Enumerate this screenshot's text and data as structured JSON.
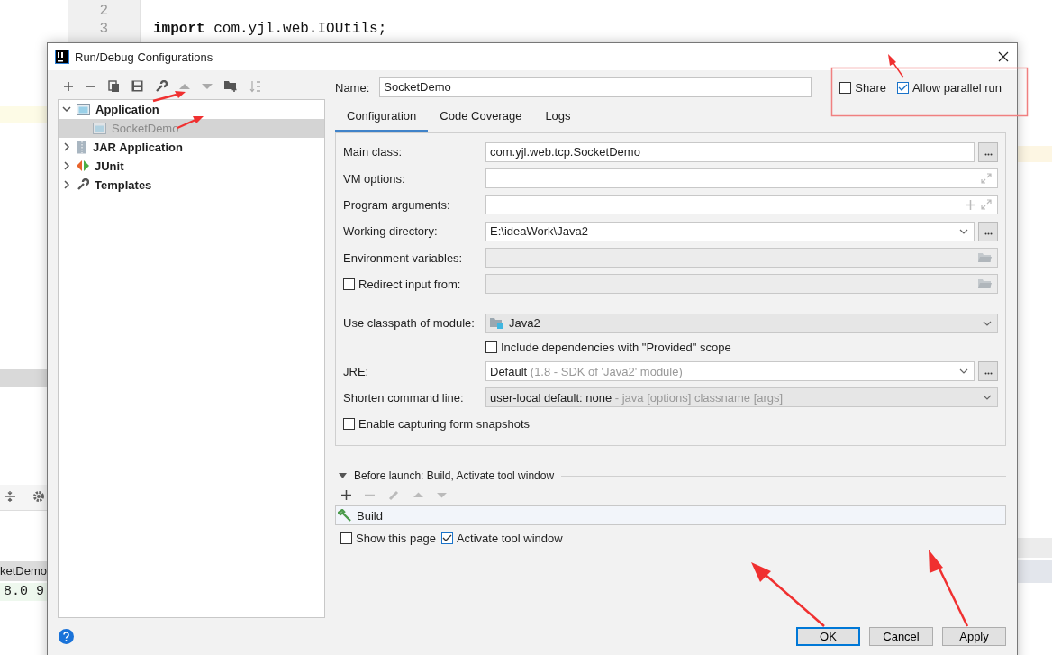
{
  "editor": {
    "lines": [
      {
        "number": "2"
      },
      {
        "number": "3",
        "code": "**import** com.yjl.web.IOUtils;"
      }
    ],
    "run_tab": "ketDemo",
    "console_text": "8.0_9"
  },
  "dialog": {
    "title": "Run/Debug Configurations",
    "tree": [
      {
        "label": "Application",
        "kind": "app",
        "expanded": true,
        "selected": false,
        "children": [
          {
            "label": "SocketDemo",
            "kind": "app",
            "selected": true
          }
        ]
      },
      {
        "label": "JAR Application",
        "kind": "jar",
        "expanded": false,
        "selected": false
      },
      {
        "label": "JUnit",
        "kind": "junit",
        "expanded": false,
        "selected": false
      },
      {
        "label": "Templates",
        "kind": "templates",
        "expanded": false,
        "selected": false
      }
    ],
    "name_label": "Name:",
    "name_value": "SocketDemo",
    "share": {
      "label": "Share",
      "checked": false
    },
    "allow_parallel": {
      "label": "Allow parallel run",
      "checked": true
    },
    "tabs": [
      {
        "label": "Configuration",
        "selected": true
      },
      {
        "label": "Code Coverage",
        "selected": false
      },
      {
        "label": "Logs",
        "selected": false
      }
    ],
    "rows": [
      {
        "kind": "field",
        "label": "Main class:",
        "value": "com.yjl.web.tcp.SocketDemo"
      },
      {
        "kind": "expand",
        "label": "VM options:"
      },
      {
        "kind": "expand_add",
        "label": "Program arguments:"
      },
      {
        "kind": "combo",
        "label": "Working directory:",
        "value": "E:\\ideaWork\\Java2"
      },
      {
        "kind": "folder",
        "label": "Environment variables:"
      },
      {
        "kind": "check_folder",
        "label": "Redirect input from:",
        "checked": false
      },
      {
        "kind": "module",
        "label": "Use classpath of module:",
        "value": "Java2"
      },
      {
        "kind": "check",
        "label": "Include dependencies with \"Provided\" scope",
        "checked": false
      },
      {
        "kind": "jre",
        "label": "JRE:",
        "value": "Default",
        "hint": "(1.8 - SDK of 'Java2' module)"
      },
      {
        "kind": "select",
        "label": "Shorten command line:",
        "value": "user-local default: none",
        "hint": "- java [options] classname [args]"
      },
      {
        "kind": "check_wide",
        "label": "Enable capturing form snapshots",
        "checked": false
      }
    ],
    "before_launch": {
      "title": "Before launch: Build, Activate tool window",
      "expanded": true,
      "tasks": [
        "Build"
      ],
      "show_page": {
        "label": "Show this page",
        "checked": false
      },
      "activate": {
        "label": "Activate tool window",
        "checked": true
      }
    },
    "buttons": [
      {
        "label": "OK",
        "default": true
      },
      {
        "label": "Cancel",
        "default": false
      },
      {
        "label": "Apply",
        "default": false
      }
    ]
  }
}
